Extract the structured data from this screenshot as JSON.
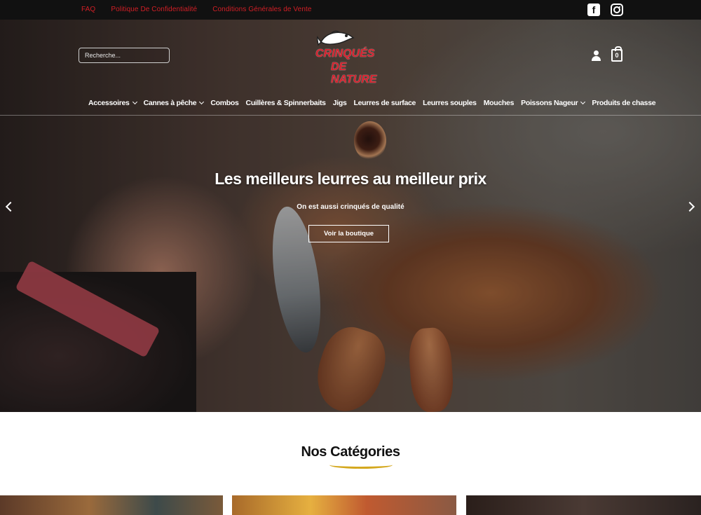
{
  "topbar": {
    "links": [
      "FAQ",
      "Politique De Confidentialité",
      "Conditions Générales de Vente"
    ],
    "social": [
      "facebook-icon",
      "instagram-icon"
    ]
  },
  "header": {
    "search_placeholder": "Recherche...",
    "logo_line1": "CRINQUÉS",
    "logo_line2": "DE NATURE",
    "cart_count": "0"
  },
  "nav": {
    "items": [
      {
        "label": "Accessoires",
        "dropdown": true
      },
      {
        "label": "Cannes à pêche",
        "dropdown": true
      },
      {
        "label": "Combos",
        "dropdown": false
      },
      {
        "label": "Cuillères & Spinnerbaits",
        "dropdown": false
      },
      {
        "label": "Jigs",
        "dropdown": false
      },
      {
        "label": "Leurres de surface",
        "dropdown": false
      },
      {
        "label": "Leurres souples",
        "dropdown": false
      },
      {
        "label": "Mouches",
        "dropdown": false
      },
      {
        "label": "Poissons Nageur",
        "dropdown": true
      },
      {
        "label": "Produits de chasse",
        "dropdown": false
      }
    ]
  },
  "hero": {
    "title": "Les meilleurs leurres au meilleur prix",
    "subtitle": "On est aussi crinqués de qualité",
    "button": "Voir la boutique"
  },
  "categories": {
    "title": "Nos Catégories"
  },
  "colors": {
    "accent_red": "#d21f26",
    "underline_gold": "#d4a81e"
  }
}
